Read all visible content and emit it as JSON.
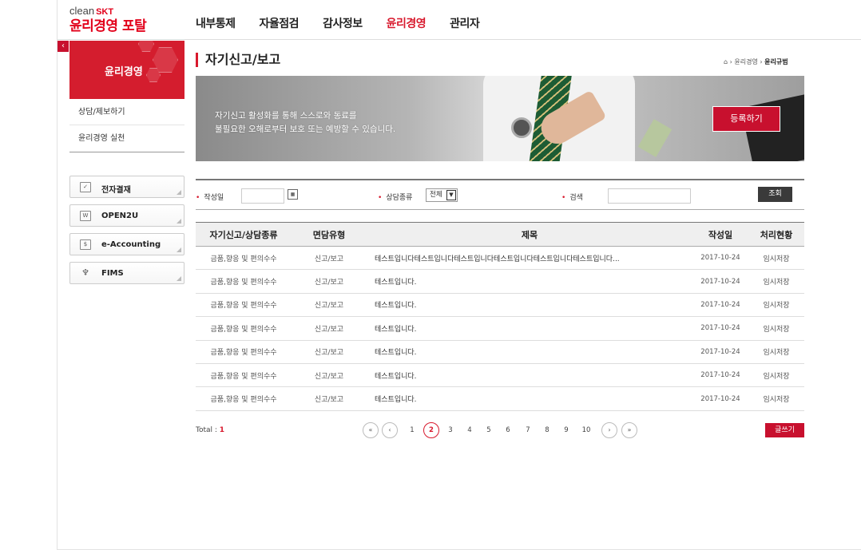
{
  "header": {
    "logo_small": "clean",
    "logo_skt": "SKT",
    "logo_main": "윤리경영 포탈",
    "nav": [
      {
        "label": "내부통제",
        "active": false
      },
      {
        "label": "자율점검",
        "active": false
      },
      {
        "label": "감사정보",
        "active": false
      },
      {
        "label": "윤리경영",
        "active": true
      },
      {
        "label": "관리자",
        "active": false
      }
    ]
  },
  "sidebar": {
    "collapse_icon": "‹",
    "banner_title": "윤리경영",
    "menu": [
      {
        "label": "상담/제보하기"
      },
      {
        "label": "윤리경영 실천"
      }
    ],
    "quick_links": [
      {
        "label": "전자결재",
        "icon": "document-check-icon"
      },
      {
        "label": "OPEN2U",
        "icon": "w-window-icon"
      },
      {
        "label": "e-Accounting",
        "icon": "currency-icon"
      },
      {
        "label": "FIMS",
        "icon": "antenna-icon"
      }
    ]
  },
  "main": {
    "title": "자기신고/보고",
    "breadcrumb": [
      "윤리경영",
      "윤리규범"
    ],
    "hero": {
      "line1": "자기신고 활성화를 통해 스스로와 동료를",
      "line2": "불필요한 오해로부터 보호 또는 예방할 수 있습니다.",
      "register_button": "등록하기"
    },
    "search": {
      "date_label": "작성일",
      "date_value": "",
      "type_label": "상담종류",
      "type_selected": "전체",
      "keyword_label": "검색",
      "keyword_value": "",
      "search_button": "조회"
    },
    "table": {
      "columns": [
        "자기신고/상담종류",
        "면담유형",
        "제목",
        "작성일",
        "처리현황"
      ],
      "rows": [
        [
          "금품,향응 및 편의수수",
          "신고/보고",
          "테스트입니다테스트입니다테스트입니다테스트입니다테스트입니다테스트입니다...",
          "2017-10-24",
          "임시저장"
        ],
        [
          "금품,향응 및 편의수수",
          "신고/보고",
          "테스트입니다.",
          "2017-10-24",
          "임시저장"
        ],
        [
          "금품,향응 및 편의수수",
          "신고/보고",
          "테스트입니다.",
          "2017-10-24",
          "임시저장"
        ],
        [
          "금품,향응 및 편의수수",
          "신고/보고",
          "테스트입니다.",
          "2017-10-24",
          "임시저장"
        ],
        [
          "금품,향응 및 편의수수",
          "신고/보고",
          "테스트입니다.",
          "2017-10-24",
          "임시저장"
        ],
        [
          "금품,향응 및 편의수수",
          "신고/보고",
          "테스트입니다.",
          "2017-10-24",
          "임시저장"
        ],
        [
          "금품,향응 및 편의수수",
          "신고/보고",
          "테스트입니다.",
          "2017-10-24",
          "임시저장"
        ]
      ]
    },
    "total_label": "Total : ",
    "total_value": "1",
    "pagination": {
      "first": "«",
      "prev": "‹",
      "pages": [
        "1",
        "2",
        "3",
        "4",
        "5",
        "6",
        "7",
        "8",
        "9",
        "10"
      ],
      "current": "2",
      "next": "›",
      "last": "»"
    },
    "write_button": "글쓰기",
    "colors": {
      "accent": "#d8192d",
      "dark_button": "#3a3a3a"
    }
  }
}
